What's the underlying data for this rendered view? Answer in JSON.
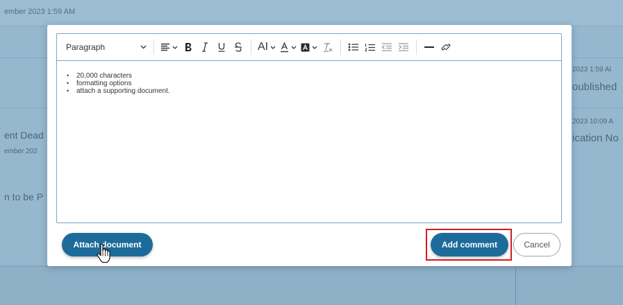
{
  "background": {
    "top_timestamp": "ember 2023 1:59 AM",
    "right_entries": [
      {
        "timestamp": "2023 1:59 AI",
        "text": "oublished"
      },
      {
        "timestamp": "2023 10:09 A",
        "text": "ication No"
      }
    ],
    "left_entries": [
      {
        "title": "ent Dead",
        "subtitle": "ember 202"
      },
      {
        "title": "n to be P"
      }
    ]
  },
  "editor": {
    "toolbar": {
      "paragraph_select": "Paragraph",
      "font_size_label": "AI"
    },
    "bullets": [
      "20,000 characters",
      "formatting options",
      "attach a supporting document."
    ]
  },
  "actions": {
    "attach_label": "Attach document",
    "add_comment_label": "Add comment",
    "cancel_label": "Cancel"
  },
  "colors": {
    "primary": "#1d6b9a",
    "highlight": "#d3191f",
    "overlay": "#95b8cf"
  }
}
